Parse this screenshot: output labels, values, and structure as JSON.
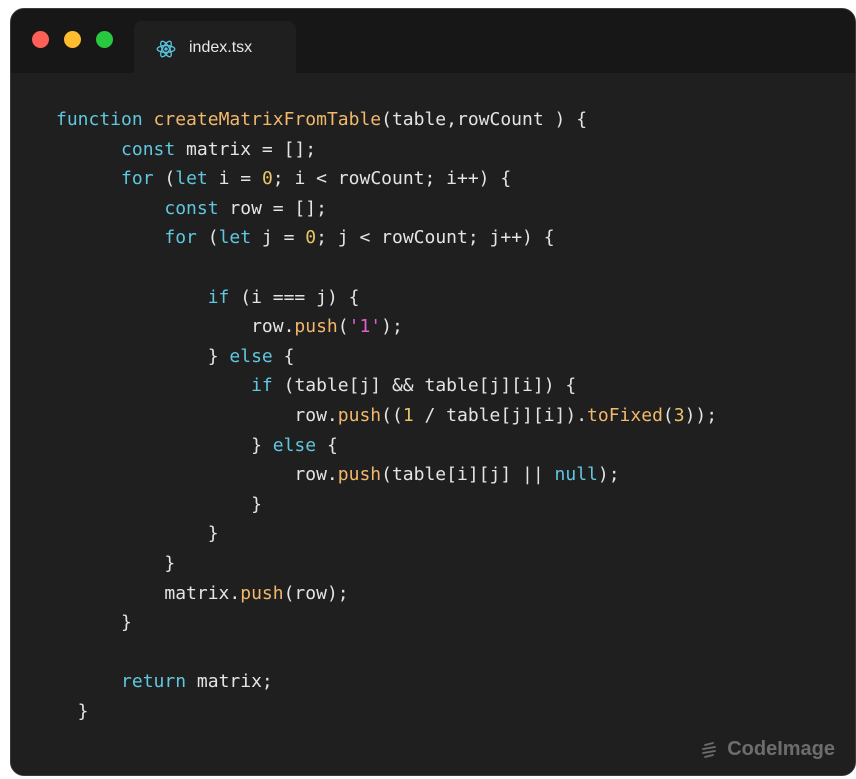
{
  "window": {
    "traffic_lights": [
      {
        "name": "close",
        "color": "#fe5f57"
      },
      {
        "name": "minimize",
        "color": "#febc2e"
      },
      {
        "name": "zoom",
        "color": "#28c840"
      }
    ]
  },
  "tab": {
    "icon": "react-icon",
    "icon_color": "#58c4dc",
    "label": "index.tsx"
  },
  "code": {
    "lines": [
      [
        {
          "t": "function ",
          "c": "kw"
        },
        {
          "t": "createMatrixFromTable",
          "c": "fn"
        },
        {
          "t": "(table,rowCount ) {",
          "c": "plain"
        }
      ],
      [
        {
          "t": "      ",
          "c": "plain"
        },
        {
          "t": "const",
          "c": "kw"
        },
        {
          "t": " matrix = [];",
          "c": "plain"
        }
      ],
      [
        {
          "t": "      ",
          "c": "plain"
        },
        {
          "t": "for",
          "c": "kw"
        },
        {
          "t": " (",
          "c": "plain"
        },
        {
          "t": "let",
          "c": "kw"
        },
        {
          "t": " i = ",
          "c": "plain"
        },
        {
          "t": "0",
          "c": "num"
        },
        {
          "t": "; i < rowCount; i++) {",
          "c": "plain"
        }
      ],
      [
        {
          "t": "          ",
          "c": "plain"
        },
        {
          "t": "const",
          "c": "kw"
        },
        {
          "t": " row = [];",
          "c": "plain"
        }
      ],
      [
        {
          "t": "          ",
          "c": "plain"
        },
        {
          "t": "for",
          "c": "kw"
        },
        {
          "t": " (",
          "c": "plain"
        },
        {
          "t": "let",
          "c": "kw"
        },
        {
          "t": " j = ",
          "c": "plain"
        },
        {
          "t": "0",
          "c": "num"
        },
        {
          "t": "; j < rowCount; j++) {",
          "c": "plain"
        }
      ],
      [
        {
          "t": "",
          "c": "plain"
        }
      ],
      [
        {
          "t": "              ",
          "c": "plain"
        },
        {
          "t": "if",
          "c": "kw"
        },
        {
          "t": " (i === j) {",
          "c": "plain"
        }
      ],
      [
        {
          "t": "                  row.",
          "c": "plain"
        },
        {
          "t": "push",
          "c": "fn"
        },
        {
          "t": "(",
          "c": "plain"
        },
        {
          "t": "'1'",
          "c": "str"
        },
        {
          "t": ");",
          "c": "plain"
        }
      ],
      [
        {
          "t": "              } ",
          "c": "plain"
        },
        {
          "t": "else",
          "c": "kw"
        },
        {
          "t": " {",
          "c": "plain"
        }
      ],
      [
        {
          "t": "                  ",
          "c": "plain"
        },
        {
          "t": "if",
          "c": "kw"
        },
        {
          "t": " (table[j] && table[j][i]) {",
          "c": "plain"
        }
      ],
      [
        {
          "t": "                      row.",
          "c": "plain"
        },
        {
          "t": "push",
          "c": "fn"
        },
        {
          "t": "((",
          "c": "plain"
        },
        {
          "t": "1",
          "c": "num"
        },
        {
          "t": " / table[j][i]).",
          "c": "plain"
        },
        {
          "t": "toFixed",
          "c": "fn"
        },
        {
          "t": "(",
          "c": "plain"
        },
        {
          "t": "3",
          "c": "num"
        },
        {
          "t": "));",
          "c": "plain"
        }
      ],
      [
        {
          "t": "                  } ",
          "c": "plain"
        },
        {
          "t": "else",
          "c": "kw"
        },
        {
          "t": " {",
          "c": "plain"
        }
      ],
      [
        {
          "t": "                      row.",
          "c": "plain"
        },
        {
          "t": "push",
          "c": "fn"
        },
        {
          "t": "(table[i][j] || ",
          "c": "plain"
        },
        {
          "t": "null",
          "c": "kw"
        },
        {
          "t": ");",
          "c": "plain"
        }
      ],
      [
        {
          "t": "                  }",
          "c": "plain"
        }
      ],
      [
        {
          "t": "              }",
          "c": "plain"
        }
      ],
      [
        {
          "t": "          }",
          "c": "plain"
        }
      ],
      [
        {
          "t": "          matrix.",
          "c": "plain"
        },
        {
          "t": "push",
          "c": "fn"
        },
        {
          "t": "(row);",
          "c": "plain"
        }
      ],
      [
        {
          "t": "      }",
          "c": "plain"
        }
      ],
      [
        {
          "t": "",
          "c": "plain"
        }
      ],
      [
        {
          "t": "      ",
          "c": "plain"
        },
        {
          "t": "return",
          "c": "kw"
        },
        {
          "t": " matrix;",
          "c": "plain"
        }
      ],
      [
        {
          "t": "  }",
          "c": "plain"
        }
      ]
    ]
  },
  "watermark": {
    "icon": "codeimage-logo-icon",
    "label": "CodeImage"
  }
}
